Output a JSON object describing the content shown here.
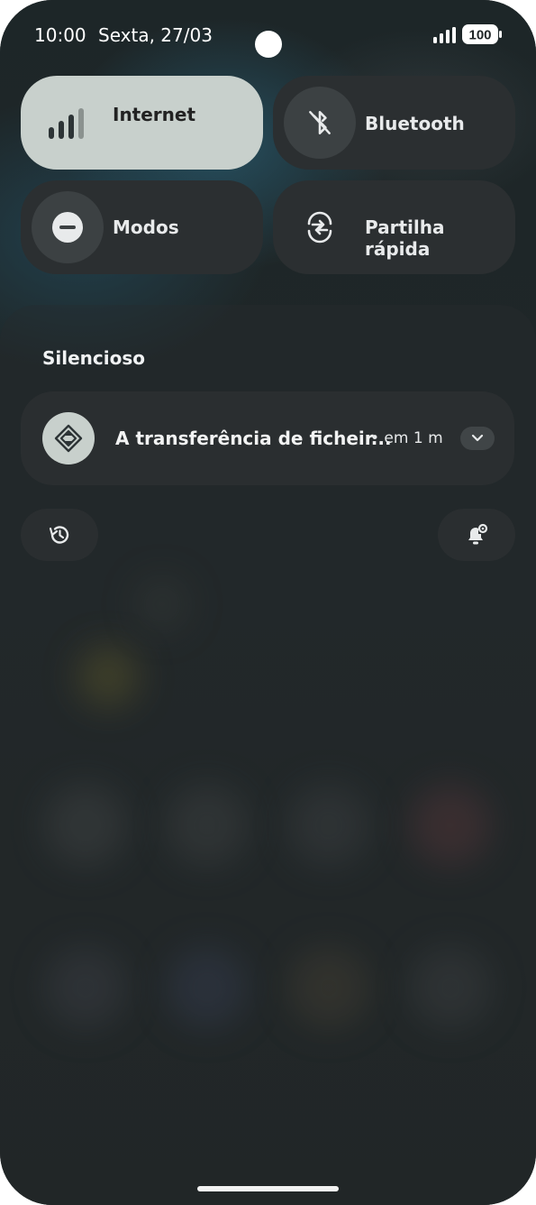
{
  "status_bar": {
    "time": "10:00",
    "date": "Sexta, 27/03",
    "battery": "100"
  },
  "quick_tiles": [
    {
      "label": "Internet",
      "icon": "signal-icon",
      "active": true
    },
    {
      "label": "Bluetooth",
      "icon": "bluetooth-off-icon",
      "active": false
    },
    {
      "label": "Modos",
      "icon": "do-not-disturb-icon",
      "active": false
    },
    {
      "label": "Partilha rápida",
      "icon": "quick-share-icon",
      "active": false
    }
  ],
  "notifications": {
    "section_title": "Silencioso",
    "items": [
      {
        "title": "A transferência de ficheir...",
        "time_ago": "• em 1 m",
        "icon": "file-transfer-icon"
      }
    ]
  },
  "buttons": {
    "history": "history-icon",
    "notification_settings": "notification-settings-icon"
  },
  "colors": {
    "active_tile": "#c8d0cc",
    "tile": "#2b2f31",
    "text": "#e8eaeb"
  }
}
